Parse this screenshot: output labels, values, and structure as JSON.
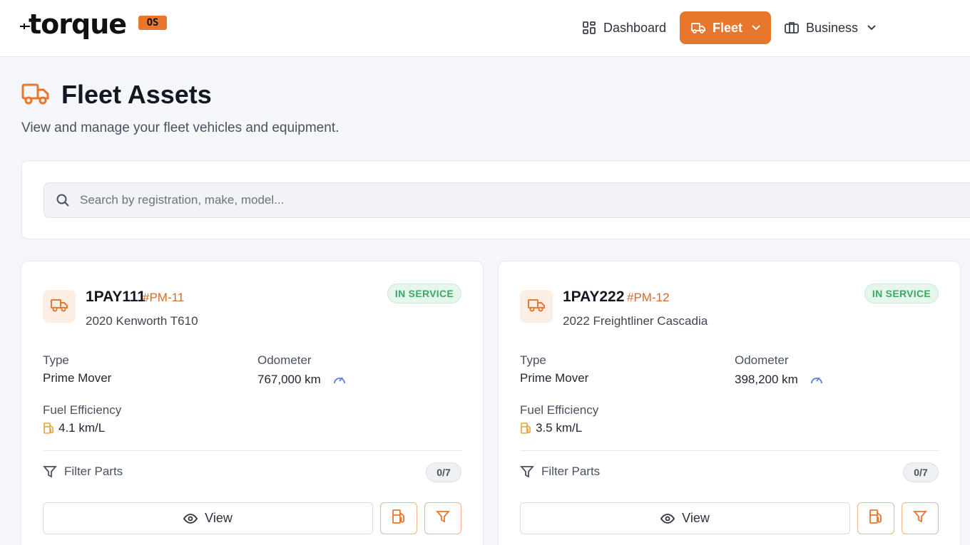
{
  "brand": {
    "logo_text": "torque",
    "logo_suffix": "OS",
    "accent": "#e8772e"
  },
  "nav": {
    "dashboard": {
      "label": "Dashboard",
      "icon": "grid-icon"
    },
    "fleet": {
      "label": "Fleet",
      "icon": "truck-icon",
      "active": true
    },
    "business": {
      "label": "Business",
      "icon": "briefcase-icon"
    }
  },
  "header": {
    "title": "Fleet Assets",
    "subtitle": "View and manage your fleet vehicles and equipment."
  },
  "search": {
    "placeholder": "Search by registration, make, model..."
  },
  "vehicles": [
    {
      "registration": "1PAY111",
      "unit_id": "#PM-11",
      "model": "2020 Kenworth T610",
      "status": "IN SERVICE",
      "type_label": "Type",
      "type": "Prime Mover",
      "odometer_label": "Odometer",
      "odometer": "767,000 km",
      "fuel_label": "Fuel Efficiency",
      "fuel": "4.1 km/L",
      "filter_label": "Filter Parts",
      "parts_count": "0/7",
      "view_label": "View"
    },
    {
      "registration": "1PAY222",
      "unit_id": "#PM-12",
      "model": "2022 Freightliner Cascadia",
      "status": "IN SERVICE",
      "type_label": "Type",
      "type": "Prime Mover",
      "odometer_label": "Odometer",
      "odometer": "398,200 km",
      "fuel_label": "Fuel Efficiency",
      "fuel": "3.5 km/L",
      "filter_label": "Filter Parts",
      "parts_count": "0/7",
      "view_label": "View"
    }
  ]
}
